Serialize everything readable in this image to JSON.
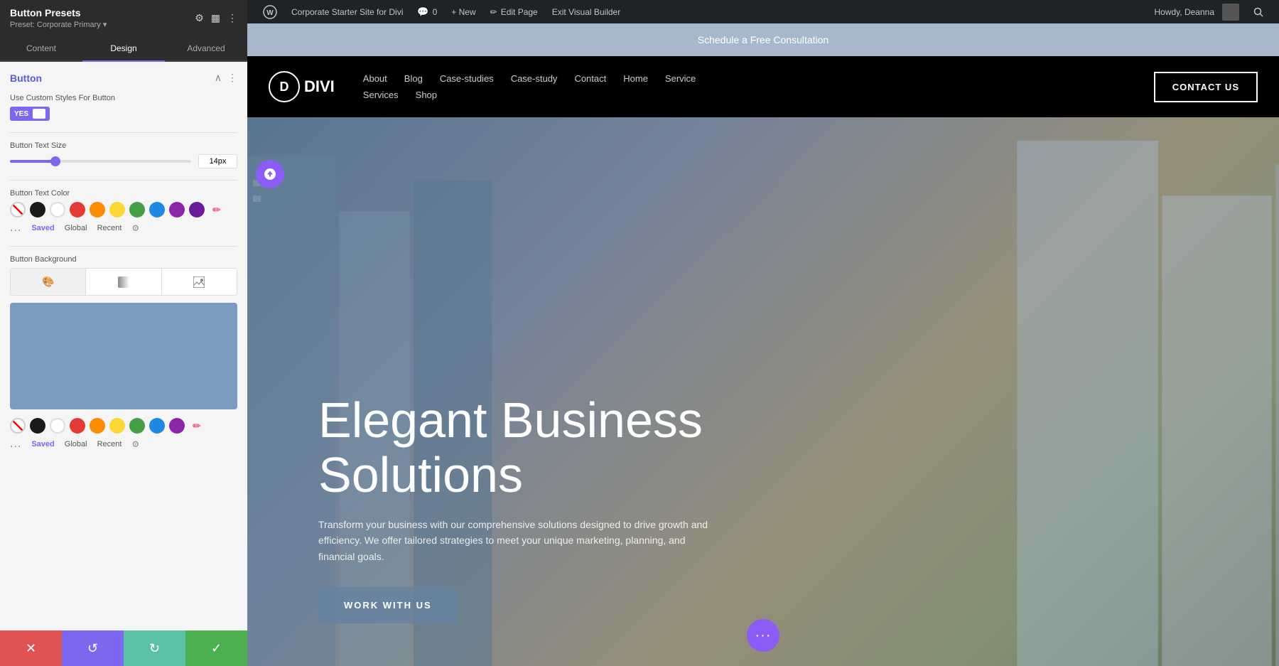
{
  "panel": {
    "title": "Button Presets",
    "preset_label": "Preset: Corporate Primary ▾",
    "tabs": [
      "Content",
      "Design",
      "Advanced"
    ],
    "active_tab": "Design",
    "section_title": "Button",
    "use_custom_label": "Use Custom Styles For Button",
    "toggle_yes": "YES",
    "button_text_size_label": "Button Text Size",
    "button_text_size_value": "14px",
    "button_text_color_label": "Button Text Color",
    "button_bg_label": "Button Background",
    "color_tabs": {
      "dots": "...",
      "saved": "Saved",
      "global": "Global",
      "recent": "Recent"
    },
    "colors": [
      {
        "name": "black",
        "hex": "#1a1a1a"
      },
      {
        "name": "white",
        "hex": "#ffffff"
      },
      {
        "name": "red",
        "hex": "#e53935"
      },
      {
        "name": "orange",
        "hex": "#fb8c00"
      },
      {
        "name": "yellow",
        "hex": "#fdd835"
      },
      {
        "name": "green",
        "hex": "#43a047"
      },
      {
        "name": "blue",
        "hex": "#1e88e5"
      },
      {
        "name": "purple",
        "hex": "#8e24aa"
      },
      {
        "name": "dark-purple",
        "hex": "#6a1b9a"
      }
    ]
  },
  "wp_bar": {
    "wp_logo": "W",
    "site_name": "Corporate Starter Site for Divi",
    "comments": "0",
    "new_label": "+ New",
    "edit_page": "Edit Page",
    "exit_builder": "Exit Visual Builder",
    "howdy": "Howdy, Deanna"
  },
  "banner": {
    "text": "Schedule a Free Consultation"
  },
  "header": {
    "logo_letter": "D",
    "logo_text": "DIVI",
    "nav_primary": [
      "About",
      "Blog",
      "Case-studies",
      "Case-study",
      "Contact",
      "Home",
      "Service"
    ],
    "nav_secondary": [
      "Services",
      "Shop"
    ],
    "contact_btn": "CONTACT US"
  },
  "hero": {
    "title_line1": "Elegant Business",
    "title_line2": "Solutions",
    "subtitle": "Transform your business with our comprehensive solutions designed to drive growth and efficiency. We offer tailored strategies to meet your unique marketing, planning, and financial goals.",
    "cta_label": "WORK WITH US",
    "float_dots": "···"
  }
}
